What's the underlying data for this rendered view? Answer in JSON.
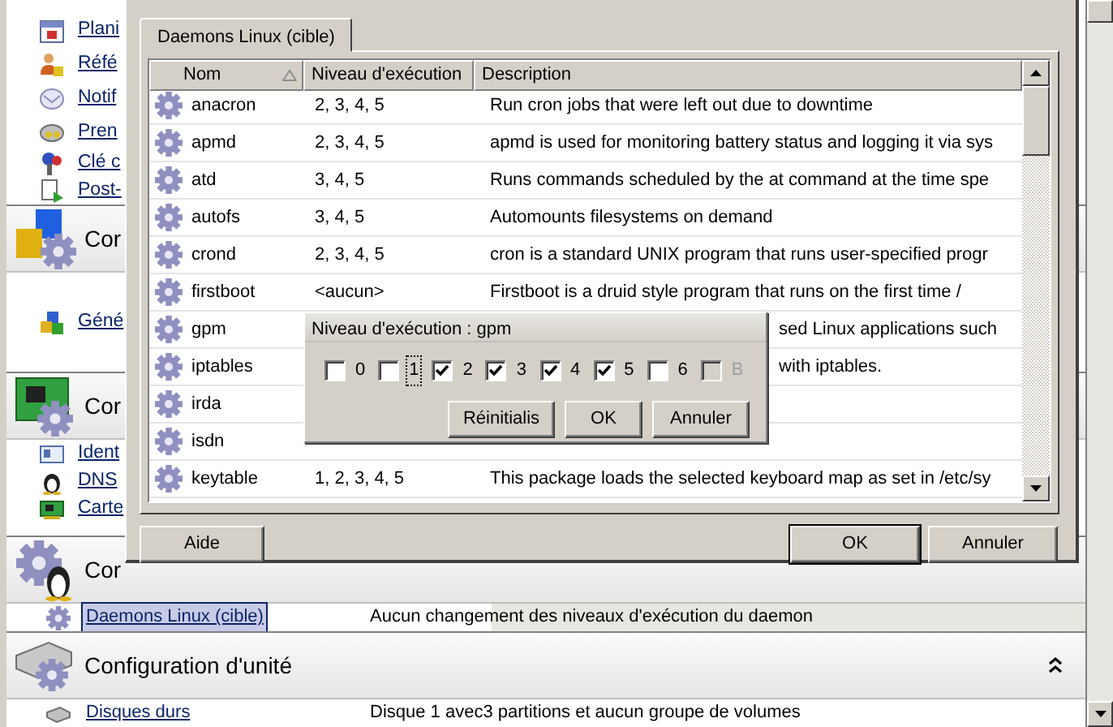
{
  "panel": [
    {
      "kind": "links",
      "items": [
        {
          "text": "Plani"
        },
        {
          "text": "Réfé"
        },
        {
          "text": "Notif"
        },
        {
          "text": "Pren"
        },
        {
          "text": "Clé c"
        },
        {
          "text": "Post-"
        }
      ]
    },
    {
      "kind": "header",
      "title": "Cor"
    },
    {
      "kind": "links",
      "items": [
        {
          "text": "Géné"
        }
      ]
    },
    {
      "kind": "header",
      "title": "Cor"
    },
    {
      "kind": "links",
      "items": [
        {
          "text": "Ident"
        },
        {
          "text": "DNS"
        },
        {
          "text": "Carte"
        }
      ]
    },
    {
      "kind": "header",
      "title": "Cor"
    },
    {
      "kind": "row",
      "label": "Daemons Linux (cible)",
      "description": "Aucun changement des niveaux d'exécution du daemon",
      "selected": true
    },
    {
      "kind": "header",
      "title": "Configuration d'unité",
      "expanded": true
    },
    {
      "kind": "row",
      "label": "Disques durs",
      "description": "Disque 1 avec3 partitions et aucun groupe de volumes",
      "selected": false
    }
  ],
  "dialog": {
    "tabs": [
      {
        "label": "Daemons Linux (cible)",
        "selected": true
      }
    ],
    "table": {
      "columns": [
        {
          "label": "Nom",
          "sorted": true
        },
        {
          "label": "Niveau d'exécution",
          "sorted": false
        },
        {
          "label": "Description",
          "sorted": false
        }
      ],
      "rows": [
        {
          "name": "anacron",
          "runlevels": "2, 3, 4, 5",
          "description": "Run cron jobs that were left out due to downtime"
        },
        {
          "name": "apmd",
          "runlevels": "2, 3, 4, 5",
          "description": "apmd is used for monitoring battery status and logging it via  sys"
        },
        {
          "name": "atd",
          "runlevels": "3, 4, 5",
          "description": "Runs commands scheduled by the at command at the time  spe"
        },
        {
          "name": "autofs",
          "runlevels": "3, 4, 5",
          "description": "Automounts filesystems on demand"
        },
        {
          "name": "crond",
          "runlevels": "2, 3, 4, 5",
          "description": "cron is a standard UNIX program that runs user-specified  progr"
        },
        {
          "name": "firstboot",
          "runlevels": "<aucun>",
          "description": "Firstboot is a druid style program that runs on the first time /"
        },
        {
          "name": "gpm",
          "description": "sed Linux applications  such"
        },
        {
          "name": "iptables",
          "description": "with iptables."
        },
        {
          "name": "irda"
        },
        {
          "name": "isdn"
        },
        {
          "name": "keytable",
          "runlevels": "1, 2, 3, 4, 5",
          "description": "This package loads the selected keyboard map as set in  /etc/sy"
        }
      ]
    },
    "buttons": [
      {
        "label": "Aide",
        "default": false
      },
      {
        "label": "OK",
        "default": true
      },
      {
        "label": "Annuler",
        "default": false
      }
    ],
    "popup": {
      "title": "Niveau d'exécution : gpm",
      "levels": [
        {
          "label": "0",
          "checked": false,
          "disabled": false,
          "focused": false
        },
        {
          "label": "1",
          "checked": false,
          "disabled": false,
          "focused": true
        },
        {
          "label": "2",
          "checked": true,
          "disabled": false,
          "focused": false
        },
        {
          "label": "3",
          "checked": true,
          "disabled": false,
          "focused": false
        },
        {
          "label": "4",
          "checked": true,
          "disabled": false,
          "focused": false
        },
        {
          "label": "5",
          "checked": true,
          "disabled": false,
          "focused": false
        },
        {
          "label": "6",
          "checked": false,
          "disabled": false,
          "focused": false
        },
        {
          "label": "B",
          "checked": false,
          "disabled": true,
          "focused": false
        }
      ],
      "buttons": [
        "Réinitialis",
        "OK",
        "Annuler"
      ]
    }
  }
}
